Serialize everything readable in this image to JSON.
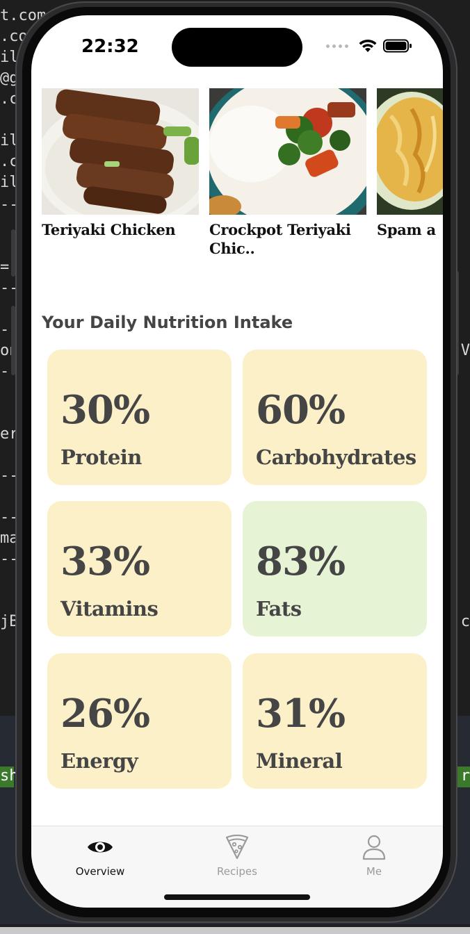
{
  "status_bar": {
    "time": "22:32"
  },
  "recipes": [
    {
      "title": "Teriyaki Chicken"
    },
    {
      "title": "Crockpot Teriyaki Chic.."
    },
    {
      "title": "Spam a"
    }
  ],
  "nutrition": {
    "title": "Your Daily Nutrition Intake",
    "items": [
      {
        "value": "30%",
        "label": "Protein",
        "color": "#fcf0c9"
      },
      {
        "value": "60%",
        "label": "Carbohydrates",
        "color": "#fcf0c9"
      },
      {
        "value": "33%",
        "label": "Vitamins",
        "color": "#fcf0c9"
      },
      {
        "value": "83%",
        "label": "Fats",
        "color": "#e7f3d5"
      },
      {
        "value": "26%",
        "label": "Energy",
        "color": "#fcf0c9"
      },
      {
        "value": "31%",
        "label": "Mineral",
        "color": "#fcf0c9"
      }
    ]
  },
  "tabbar": {
    "tabs": [
      {
        "label": "Overview",
        "icon": "eye-icon",
        "active": true
      },
      {
        "label": "Recipes",
        "icon": "pizza-slice-icon",
        "active": false
      },
      {
        "label": "Me",
        "icon": "person-icon",
        "active": false
      }
    ]
  },
  "terminal": {
    "left_lines": [
      "t.com",
      ".co",
      "il",
      "@g",
      ".c",
      "",
      "il",
      ".c",
      "il",
      "--",
      "",
      "=",
      "--",
      "",
      "--",
      "on",
      "--",
      "",
      "er",
      "",
      "--",
      "",
      "--",
      "ma",
      "--",
      "",
      "jB"
    ],
    "right_lines": [
      "V",
      ".c",
      "r"
    ]
  }
}
